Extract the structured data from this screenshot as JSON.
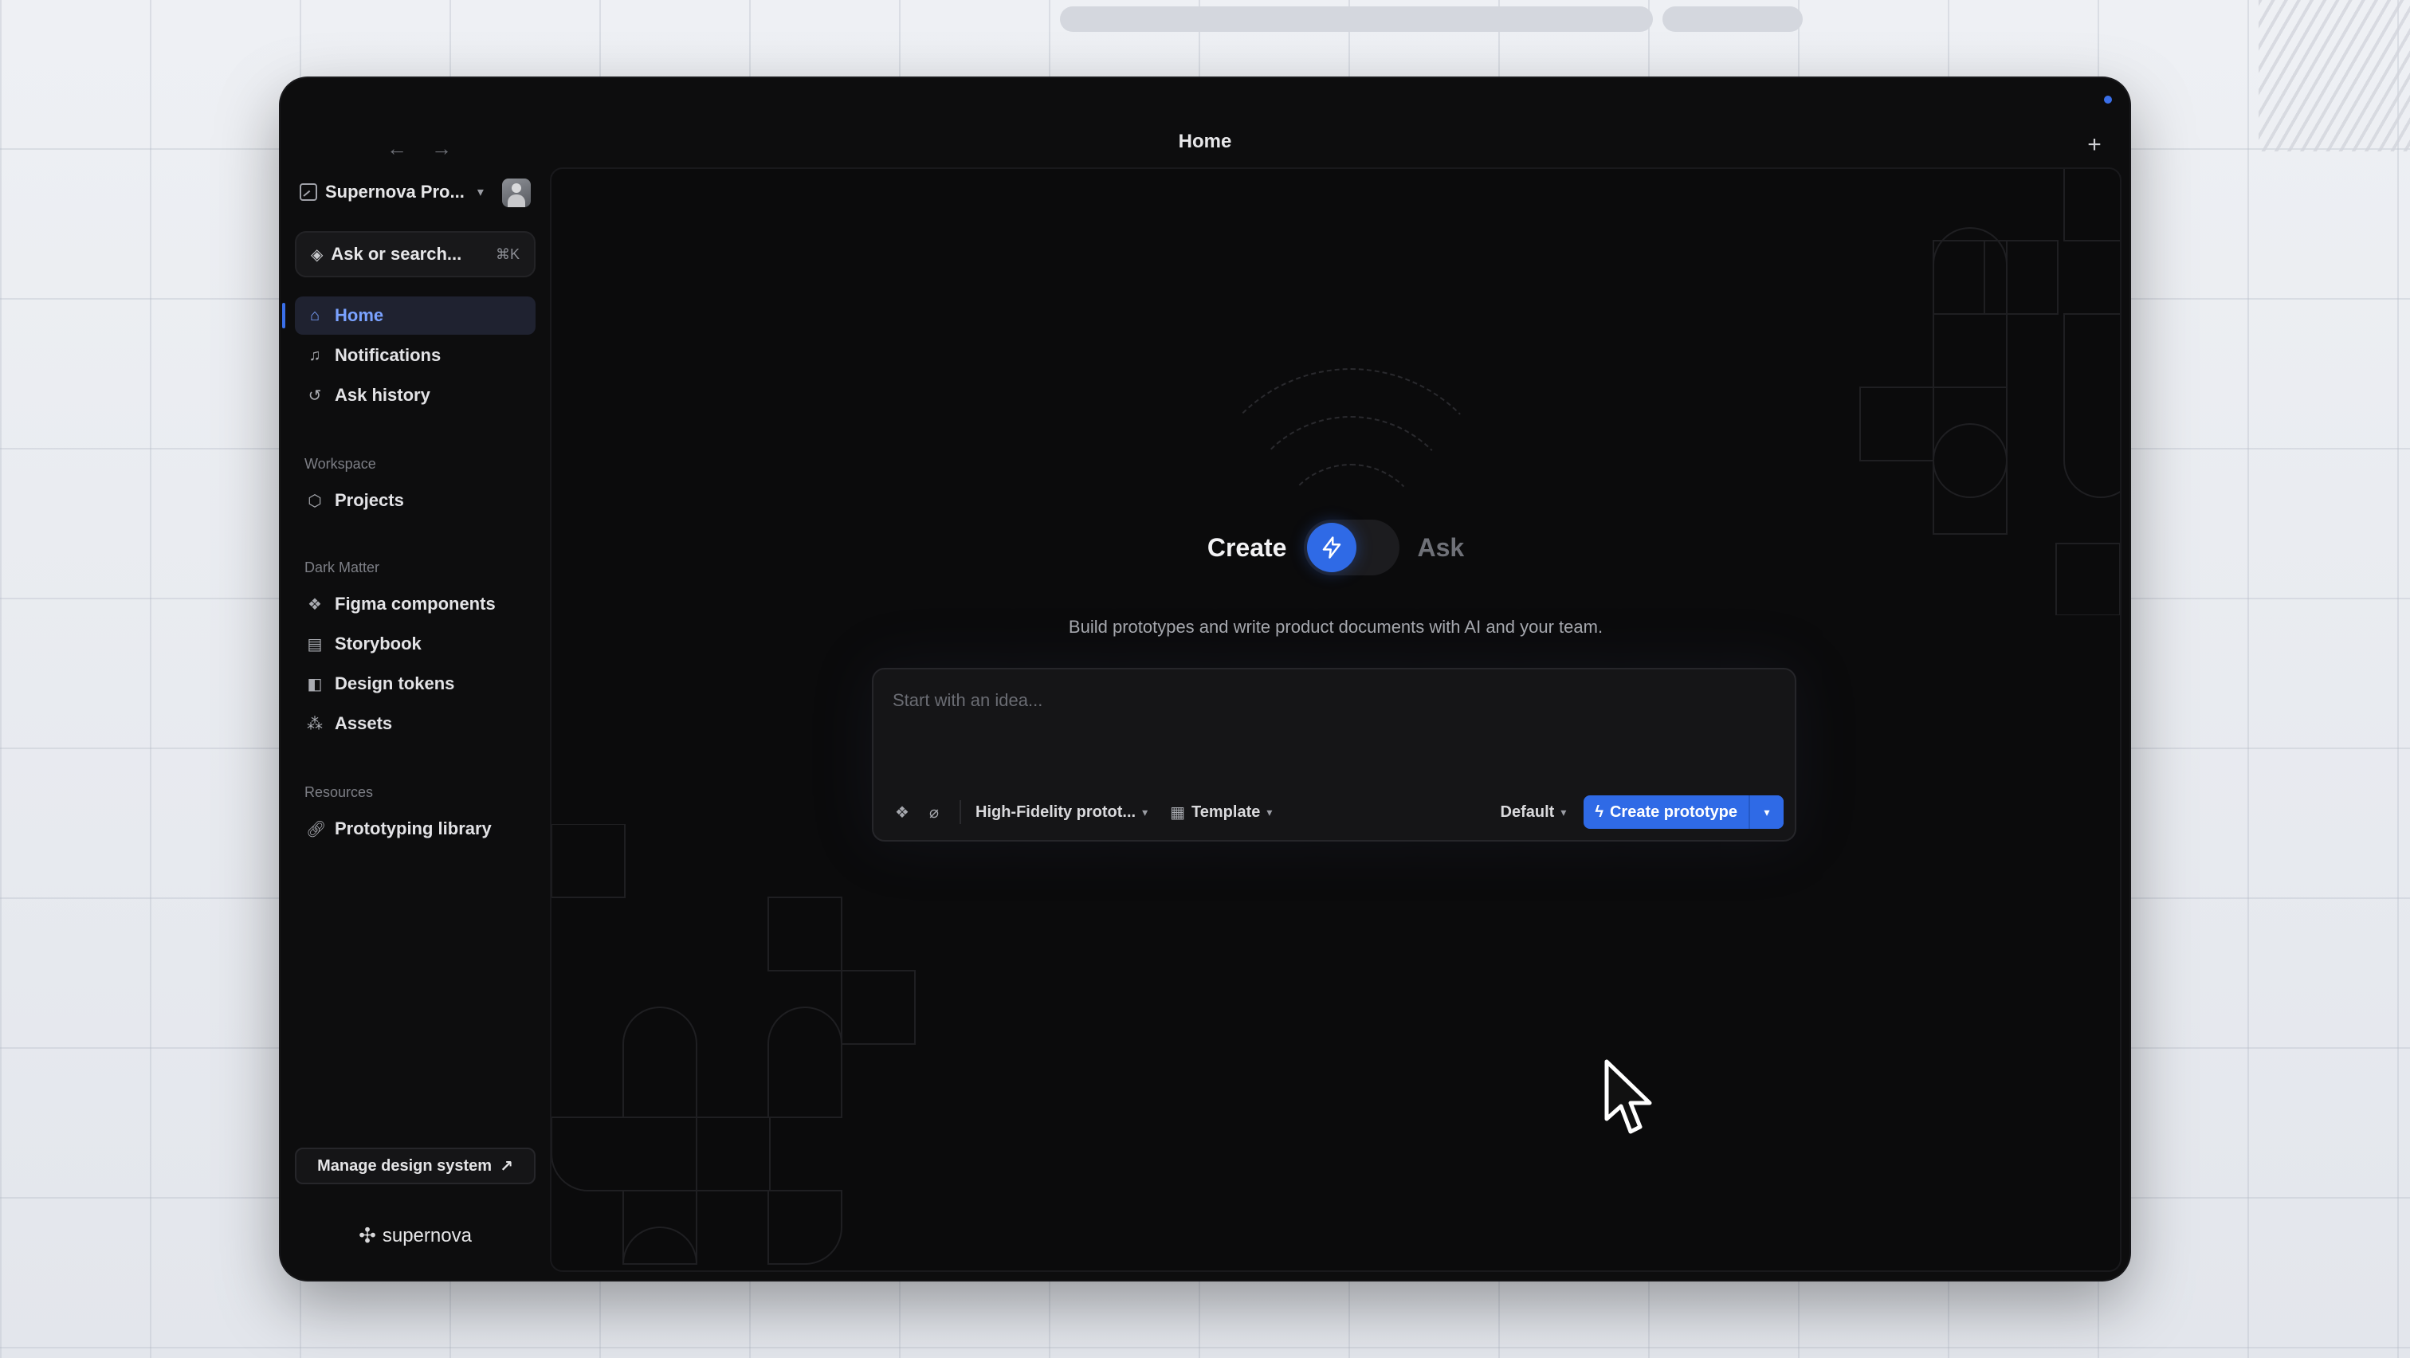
{
  "window": {
    "title": "Home",
    "back_icon": "arrow-left-icon",
    "forward_icon": "arrow-right-icon",
    "new_tab_icon": "plus-icon"
  },
  "sidebar": {
    "team_name": "Supernova Pro...",
    "search_placeholder": "Ask or search...",
    "search_shortcut": "⌘K",
    "primary_items": [
      {
        "label": "Home",
        "icon": "home-icon",
        "active": true
      },
      {
        "label": "Notifications",
        "icon": "bell-icon"
      },
      {
        "label": "Ask history",
        "icon": "history-icon"
      }
    ],
    "workspace_title": "Workspace",
    "workspace_items": [
      {
        "label": "Projects",
        "icon": "cube-icon"
      }
    ],
    "dark_matter_title": "Dark Matter",
    "dark_matter_items": [
      {
        "label": "Figma components",
        "icon": "figma-icon"
      },
      {
        "label": "Storybook",
        "icon": "book-icon"
      },
      {
        "label": "Design tokens",
        "icon": "tokens-icon"
      },
      {
        "label": "Assets",
        "icon": "assets-icon"
      }
    ],
    "resources_title": "Resources",
    "resources_items": [
      {
        "label": "Prototyping library",
        "icon": "link-icon"
      }
    ],
    "manage_button": "Manage design system",
    "brand": "supernova"
  },
  "main": {
    "toggle_left": "Create",
    "toggle_right": "Ask",
    "subtitle": "Build prototypes and write product documents with AI and your team.",
    "prompt_placeholder": "Start with an idea...",
    "fidelity_select": "High-Fidelity protot...",
    "template_select": "Template",
    "theme_select": "Default",
    "create_button": "Create prototype"
  },
  "colors": {
    "accent": "#2f6ae6",
    "window_bg": "#0d0d0e",
    "active_nav": "#1f2230"
  }
}
